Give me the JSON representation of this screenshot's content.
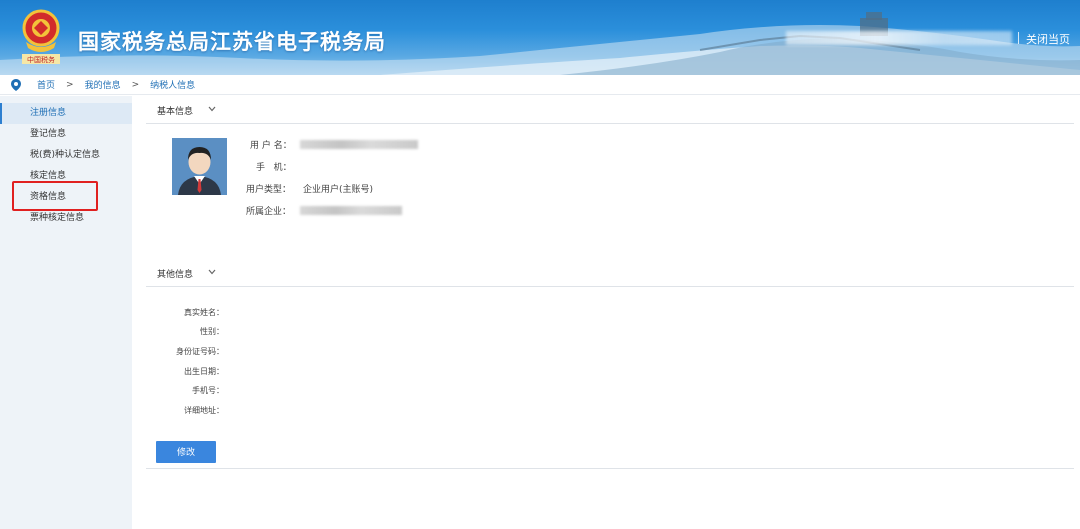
{
  "header": {
    "title": "国家税务总局江苏省电子税务局",
    "logo_icon": "tax-emblem-icon",
    "close_label": "关闭当页"
  },
  "breadcrumb": {
    "icon": "location-pin-icon",
    "items": [
      "首页",
      "我的信息",
      "纳税人信息"
    ],
    "separator": ">"
  },
  "sidebar": {
    "items": [
      {
        "label": "注册信息",
        "active": true
      },
      {
        "label": "登记信息"
      },
      {
        "label": "税(费)种认定信息"
      },
      {
        "label": "核定信息"
      },
      {
        "label": "资格信息",
        "highlighted": true
      },
      {
        "label": "票种核定信息"
      }
    ]
  },
  "basic_info": {
    "title": "基本信息",
    "avatar_icon": "user-avatar-icon",
    "fields": [
      {
        "label": "用 户 名："
      },
      {
        "label": "手   机："
      },
      {
        "label": "用户类型：",
        "value": "企业用户(主账号)"
      },
      {
        "label": "所属企业："
      }
    ]
  },
  "other_info": {
    "title": "其他信息",
    "fields": [
      "真实姓名：",
      "性别：",
      "身份证号码：",
      "出生日期：",
      "手机号：",
      "详细地址："
    ]
  },
  "actions": {
    "edit_label": "修改"
  },
  "colors": {
    "header_blue": "#1e7fce",
    "link_blue": "#1f6fb5",
    "button_blue": "#3a86de",
    "highlight_red": "#e02020",
    "sidebar_bg": "#eef3f8"
  }
}
